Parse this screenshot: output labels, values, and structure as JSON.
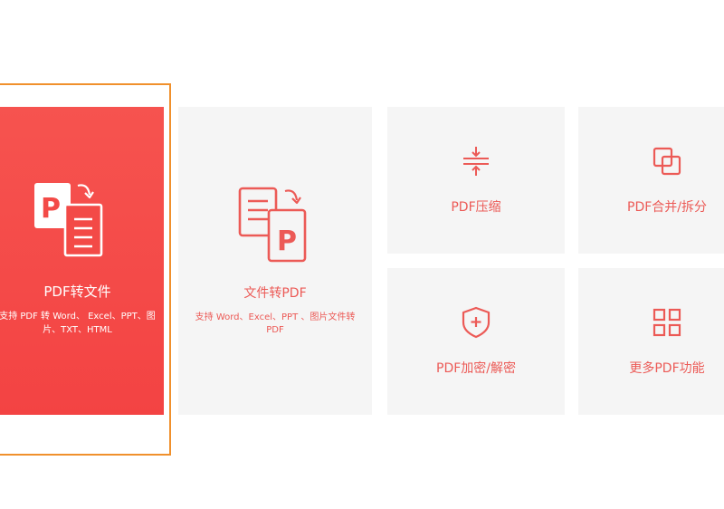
{
  "colors": {
    "accent": "#ec5a56",
    "primary_card": "#f34a47",
    "selection_border": "#f0902c",
    "tile_bg": "#f5f5f5"
  },
  "cards": {
    "pdf_to_file": {
      "icon": "pdf-to-file-icon",
      "title": "PDF转文件",
      "description": "支持 PDF 转 Word、 Excel、PPT、图片、TXT、HTML"
    },
    "file_to_pdf": {
      "icon": "file-to-pdf-icon",
      "title": "文件转PDF",
      "description": "支持 Word、Excel、PPT 、图片文件转 PDF"
    },
    "compress": {
      "icon": "compress-icon",
      "title": "PDF压缩"
    },
    "merge_split": {
      "icon": "merge-split-icon",
      "title": "PDF合并/拆分"
    },
    "encrypt": {
      "icon": "shield-plus-icon",
      "title": "PDF加密/解密"
    },
    "more": {
      "icon": "grid-icon",
      "title": "更多PDF功能"
    }
  }
}
